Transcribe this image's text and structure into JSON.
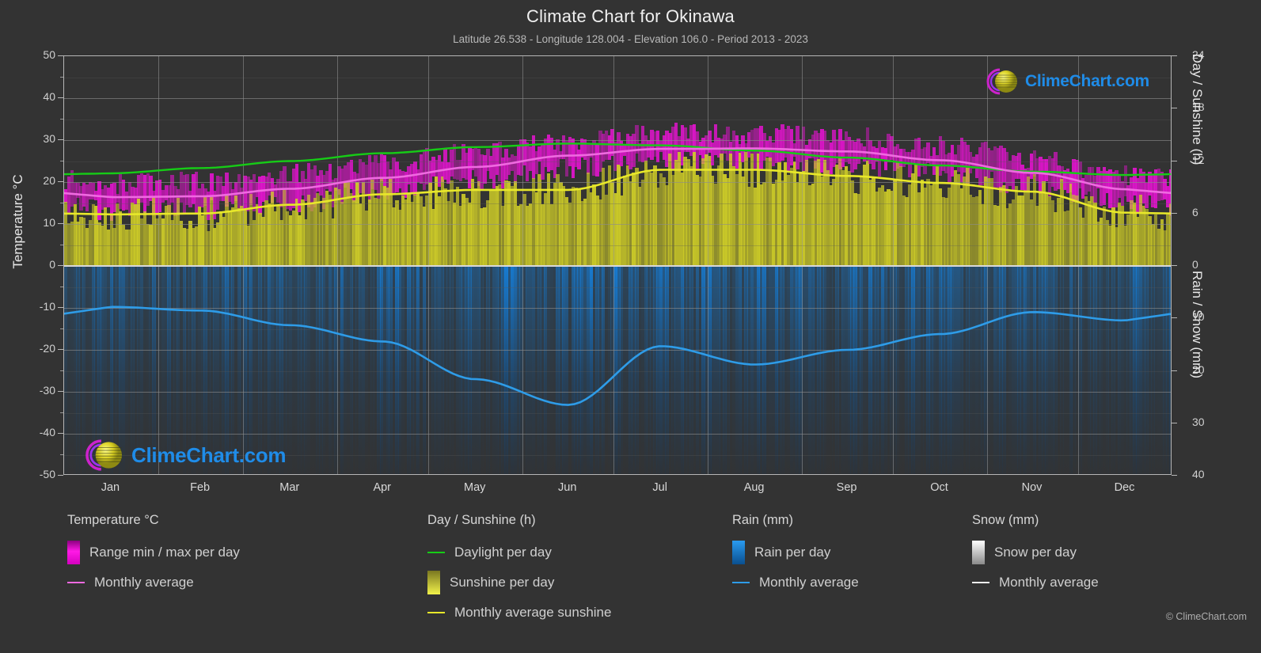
{
  "header": {
    "title": "Climate Chart for Okinawa",
    "subtitle": "Latitude 26.538 - Longitude 128.004 - Elevation 106.0 - Period 2013 - 2023"
  },
  "logo": {
    "text": "ClimeChart.com"
  },
  "copyright": "© ClimeChart.com",
  "axes": {
    "left_title": "Temperature °C",
    "right_title_top": "Day / Sunshine (h)",
    "right_title_bottom": "Rain / Snow (mm)",
    "left_ticks": [
      "50",
      "40",
      "30",
      "20",
      "10",
      "0",
      "-10",
      "-20",
      "-30",
      "-40",
      "-50"
    ],
    "right_ticks_top": [
      "24",
      "18",
      "12",
      "6",
      "0"
    ],
    "right_ticks_bottom": [
      "10",
      "20",
      "30",
      "40"
    ],
    "x_ticks": [
      "Jan",
      "Feb",
      "Mar",
      "Apr",
      "May",
      "Jun",
      "Jul",
      "Aug",
      "Sep",
      "Oct",
      "Nov",
      "Dec"
    ]
  },
  "legend": {
    "groups": [
      {
        "title": "Temperature °C",
        "items": [
          {
            "label": "Range min / max per day",
            "marker": "swatch",
            "color": "#ee00dd"
          },
          {
            "label": "Monthly average",
            "marker": "line",
            "color": "#ef6ae0"
          }
        ]
      },
      {
        "title": "Day / Sunshine (h)",
        "items": [
          {
            "label": "Daylight per day",
            "marker": "line",
            "color": "#16cc16"
          },
          {
            "label": "Sunshine per day",
            "marker": "swatch",
            "color": "#e8e82a"
          },
          {
            "label": "Monthly average sunshine",
            "marker": "line",
            "color": "#e8e82a"
          }
        ]
      },
      {
        "title": "Rain (mm)",
        "items": [
          {
            "label": "Rain per day",
            "marker": "swatch",
            "color": "#1184e0"
          },
          {
            "label": "Monthly average",
            "marker": "line",
            "color": "#2e9ce8"
          }
        ]
      },
      {
        "title": "Snow (mm)",
        "items": [
          {
            "label": "Snow per day",
            "marker": "swatch",
            "color": "#e8e8e8"
          },
          {
            "label": "Monthly average",
            "marker": "line",
            "color": "#f0f0f0"
          }
        ]
      }
    ]
  },
  "colors": {
    "background": "#333333",
    "grid_major": "#8d8d8d",
    "grid_minor": "#5a5a5a",
    "frame": "#b6b6b6",
    "temp_range": "#ee00dd",
    "temp_avg": "#ef6ae0",
    "daylight": "#16cc16",
    "sunshine": "#e8e82a",
    "rain": "#1184e0",
    "rain_avg": "#2e9ce8",
    "text": "#d0d0d0"
  },
  "chart_data": {
    "type": "area",
    "title": "Climate Chart for Okinawa",
    "subtitle": "Latitude 26.538 - Longitude 128.004 - Elevation 106.0 - Period 2013 - 2023",
    "xlabel": "",
    "ylabel": "Temperature °C",
    "ylim": [
      -50,
      50
    ],
    "y2lim_top": [
      0,
      24
    ],
    "y2lim_bottom": [
      0,
      40
    ],
    "grid": true,
    "legend_position": "below",
    "categories": [
      "Jan",
      "Feb",
      "Mar",
      "Apr",
      "May",
      "Jun",
      "Jul",
      "Aug",
      "Sep",
      "Oct",
      "Nov",
      "Dec"
    ],
    "series": [
      {
        "name": "Monthly average temperature",
        "unit": "°C",
        "color": "#ef6ae0",
        "axis": "left",
        "values": [
          16.4,
          16.6,
          18.4,
          21.0,
          23.6,
          26.3,
          27.9,
          28.0,
          27.3,
          25.2,
          22.2,
          18.3
        ]
      },
      {
        "name": "Daily max temperature (range top)",
        "unit": "°C",
        "color": "#ee00dd",
        "axis": "left",
        "values": [
          19.4,
          19.7,
          21.6,
          24.3,
          27.0,
          29.6,
          31.4,
          31.3,
          30.5,
          28.4,
          25.3,
          21.4
        ]
      },
      {
        "name": "Daily min temperature (range bottom)",
        "unit": "°C",
        "color": "#ee00dd",
        "axis": "left",
        "values": [
          13.4,
          13.6,
          15.3,
          18.0,
          20.6,
          23.6,
          25.1,
          25.2,
          24.4,
          22.2,
          19.2,
          15.4
        ]
      },
      {
        "name": "Daylight per day",
        "unit": "h",
        "color": "#16cc16",
        "axis": "right_top",
        "values": [
          10.6,
          11.2,
          12.0,
          12.9,
          13.6,
          14.0,
          13.8,
          13.2,
          12.4,
          11.5,
          10.8,
          10.4
        ]
      },
      {
        "name": "Monthly average sunshine",
        "unit": "h",
        "color": "#e8e82a",
        "axis": "right_top",
        "values": [
          5.9,
          6.0,
          7.0,
          8.2,
          8.7,
          8.7,
          11.0,
          11.0,
          10.3,
          9.5,
          8.5,
          6.1
        ]
      },
      {
        "name": "Rain monthly average",
        "unit": "mm",
        "color": "#2e9ce8",
        "axis": "right_bottom",
        "values": [
          7.8,
          8.5,
          11.3,
          14.4,
          21.6,
          26.5,
          15.3,
          18.8,
          16.0,
          13.0,
          8.8,
          10.4
        ]
      }
    ],
    "notes": "Daily data drawn as fine vertical strips: magenta temperature min/max range, yellow sunshine hours, blue rain per day below zero line."
  }
}
